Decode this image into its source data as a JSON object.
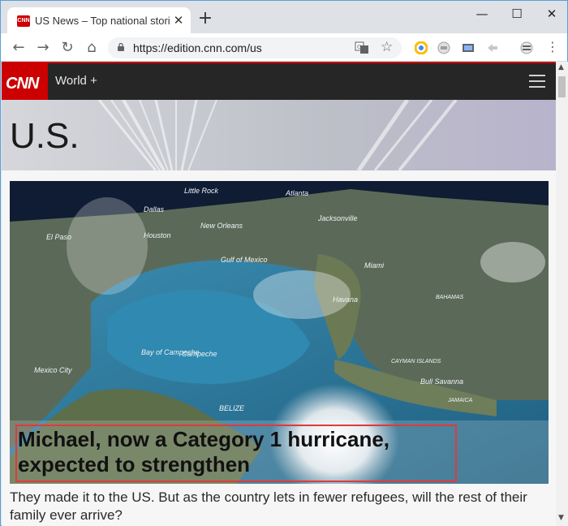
{
  "tab": {
    "favicon_text": "CNN",
    "title": "US News – Top national stories",
    "close": "✕"
  },
  "new_tab": "+",
  "window_controls": {
    "minimize": "—",
    "maximize": "☐",
    "close": "✕"
  },
  "toolbar": {
    "back": "←",
    "forward": "→",
    "reload": "↻",
    "home": "⌂",
    "url": "https://edition.cnn.com/us",
    "star": "☆",
    "menu": "⋮"
  },
  "site": {
    "logo": "CNN",
    "nav": "World +"
  },
  "page": {
    "section_title": "U.S.",
    "hero_map_labels": [
      "Atlanta",
      "Dallas",
      "Little Rock",
      "Jacksonville",
      "New Orleans",
      "Houston",
      "El Paso",
      "Gulf of Mexico",
      "Miami",
      "Havana",
      "Bay of Campeche",
      "Campeche",
      "Mexico City",
      "Bull Savanna",
      "BELIZE",
      "JAMAICA",
      "CAYMAN ISLANDS",
      "BAHAMAS"
    ],
    "headline": "Michael, now a Category 1 hurricane, expected to strengthen",
    "caption": "They made it to the US. But as the country lets in fewer refugees, will the rest of their family ever arrive?"
  },
  "colors": {
    "brand_red": "#cc0000",
    "nav_bar": "#262626",
    "highlight_border": "#e03a3a"
  }
}
